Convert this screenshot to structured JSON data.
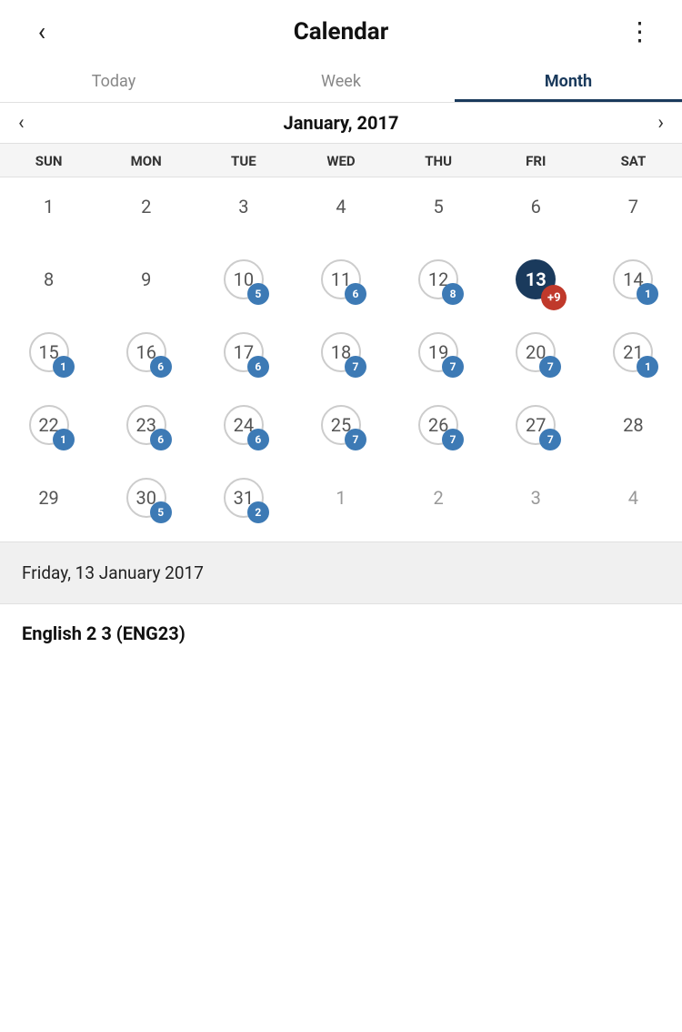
{
  "header": {
    "title": "Calendar",
    "back_label": "‹",
    "more_label": "⋮"
  },
  "tabs": [
    {
      "label": "Today",
      "active": false
    },
    {
      "label": "Week",
      "active": false
    },
    {
      "label": "Month",
      "active": true
    }
  ],
  "month_nav": {
    "title": "January, 2017",
    "left_arrow": "‹",
    "right_arrow": "›"
  },
  "day_headers": [
    "SUN",
    "MON",
    "TUE",
    "WED",
    "THU",
    "FRI",
    "SAT"
  ],
  "weeks": [
    [
      {
        "day": "1",
        "current": true,
        "ring": false,
        "today": false,
        "badge": null
      },
      {
        "day": "2",
        "current": true,
        "ring": false,
        "today": false,
        "badge": null
      },
      {
        "day": "3",
        "current": true,
        "ring": false,
        "today": false,
        "badge": null
      },
      {
        "day": "4",
        "current": true,
        "ring": false,
        "today": false,
        "badge": null
      },
      {
        "day": "5",
        "current": true,
        "ring": false,
        "today": false,
        "badge": null
      },
      {
        "day": "6",
        "current": true,
        "ring": false,
        "today": false,
        "badge": null
      },
      {
        "day": "7",
        "current": true,
        "ring": false,
        "today": false,
        "badge": null
      }
    ],
    [
      {
        "day": "8",
        "current": true,
        "ring": false,
        "today": false,
        "badge": null
      },
      {
        "day": "9",
        "current": true,
        "ring": false,
        "today": false,
        "badge": null
      },
      {
        "day": "10",
        "current": true,
        "ring": true,
        "today": false,
        "badge": "5"
      },
      {
        "day": "11",
        "current": true,
        "ring": true,
        "today": false,
        "badge": "6"
      },
      {
        "day": "12",
        "current": true,
        "ring": true,
        "today": false,
        "badge": "8"
      },
      {
        "day": "13",
        "current": true,
        "ring": false,
        "today": true,
        "badge": "+9",
        "badge_red": true
      },
      {
        "day": "14",
        "current": true,
        "ring": true,
        "today": false,
        "badge": "1"
      }
    ],
    [
      {
        "day": "15",
        "current": true,
        "ring": true,
        "today": false,
        "badge": "1"
      },
      {
        "day": "16",
        "current": true,
        "ring": true,
        "today": false,
        "badge": "6"
      },
      {
        "day": "17",
        "current": true,
        "ring": true,
        "today": false,
        "badge": "6"
      },
      {
        "day": "18",
        "current": true,
        "ring": true,
        "today": false,
        "badge": "7"
      },
      {
        "day": "19",
        "current": true,
        "ring": true,
        "today": false,
        "badge": "7"
      },
      {
        "day": "20",
        "current": true,
        "ring": true,
        "today": false,
        "badge": "7"
      },
      {
        "day": "21",
        "current": true,
        "ring": true,
        "today": false,
        "badge": "1"
      }
    ],
    [
      {
        "day": "22",
        "current": true,
        "ring": true,
        "today": false,
        "badge": "1"
      },
      {
        "day": "23",
        "current": true,
        "ring": true,
        "today": false,
        "badge": "6"
      },
      {
        "day": "24",
        "current": true,
        "ring": true,
        "today": false,
        "badge": "6"
      },
      {
        "day": "25",
        "current": true,
        "ring": true,
        "today": false,
        "badge": "7"
      },
      {
        "day": "26",
        "current": true,
        "ring": true,
        "today": false,
        "badge": "7"
      },
      {
        "day": "27",
        "current": true,
        "ring": true,
        "today": false,
        "badge": "7"
      },
      {
        "day": "28",
        "current": true,
        "ring": false,
        "today": false,
        "badge": null
      }
    ],
    [
      {
        "day": "29",
        "current": true,
        "ring": false,
        "today": false,
        "badge": null
      },
      {
        "day": "30",
        "current": true,
        "ring": true,
        "today": false,
        "badge": "5"
      },
      {
        "day": "31",
        "current": true,
        "ring": true,
        "today": false,
        "badge": "2"
      },
      {
        "day": "1",
        "current": false,
        "ring": false,
        "today": false,
        "badge": null
      },
      {
        "day": "2",
        "current": false,
        "ring": false,
        "today": false,
        "badge": null
      },
      {
        "day": "3",
        "current": false,
        "ring": false,
        "today": false,
        "badge": null
      },
      {
        "day": "4",
        "current": false,
        "ring": false,
        "today": false,
        "badge": null
      }
    ]
  ],
  "footer": {
    "selected_date": "Friday, 13 January 2017"
  },
  "event": {
    "title": "English 2 3 (ENG23)"
  },
  "colors": {
    "accent_dark": "#1a3a5c",
    "badge_blue": "#3d7ab5",
    "badge_red": "#c0392b",
    "ring": "#cccccc"
  }
}
